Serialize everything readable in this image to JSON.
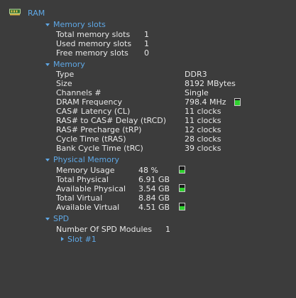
{
  "root": {
    "label": "RAM",
    "icon": "ram-chip-icon",
    "accent": "#5fa8e6"
  },
  "memory_slots": {
    "label": "Memory slots",
    "rows": [
      {
        "key": "Total memory slots",
        "value": "1"
      },
      {
        "key": "Used memory slots",
        "value": "1"
      },
      {
        "key": "Free memory slots",
        "value": "0"
      }
    ]
  },
  "memory": {
    "label": "Memory",
    "rows": [
      {
        "key": "Type",
        "value": "DDR3"
      },
      {
        "key": "Size",
        "value": "8192 MBytes"
      },
      {
        "key": "Channels #",
        "value": "Single"
      },
      {
        "key": "DRAM Frequency",
        "value": "798.4 MHz",
        "gauge_level": 0.8
      },
      {
        "key": "CAS# Latency (CL)",
        "value": "11 clocks"
      },
      {
        "key": "RAS# to CAS# Delay (tRCD)",
        "value": "11 clocks"
      },
      {
        "key": "RAS# Precharge (tRP)",
        "value": "12 clocks"
      },
      {
        "key": "Cycle Time (tRAS)",
        "value": "28 clocks"
      },
      {
        "key": "Bank Cycle Time (tRC)",
        "value": "39 clocks"
      }
    ]
  },
  "physical_memory": {
    "label": "Physical Memory",
    "rows": [
      {
        "key": "Memory Usage",
        "value": "48 %",
        "gauge_level": 0.48
      },
      {
        "key": "Total Physical",
        "value": "6.91 GB"
      },
      {
        "key": "Available Physical",
        "value": "3.54 GB",
        "gauge_level": 0.51
      },
      {
        "key": "Total Virtual",
        "value": "8.84 GB"
      },
      {
        "key": "Available Virtual",
        "value": "4.51 GB",
        "gauge_level": 0.51
      }
    ]
  },
  "spd": {
    "label": "SPD",
    "rows": [
      {
        "key": "Number Of SPD Modules",
        "value": "1"
      }
    ],
    "children": [
      {
        "label": "Slot #1"
      }
    ]
  },
  "colors": {
    "gauge_fill": "#2fd12f",
    "background": "#3c3c3c",
    "text": "#e8e8e8"
  }
}
